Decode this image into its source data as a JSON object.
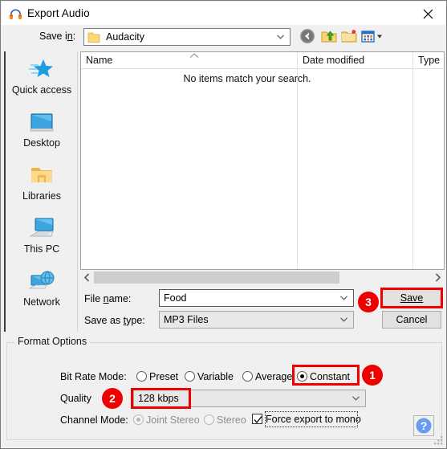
{
  "window": {
    "title": "Export Audio",
    "icon": "audacity-headphones-icon",
    "close_label": "✕"
  },
  "navbar": {
    "save_in_label": "Save in:",
    "save_in_value": "Audacity",
    "buttons": [
      {
        "name": "back-button",
        "icon": "back-arrow-icon"
      },
      {
        "name": "up-one-level-button",
        "icon": "up-folder-icon"
      },
      {
        "name": "new-folder-button",
        "icon": "new-folder-icon"
      },
      {
        "name": "view-mode-button",
        "icon": "views-dropdown-icon"
      }
    ]
  },
  "places": [
    {
      "label": "Quick access",
      "icon": "quick-access-star-icon"
    },
    {
      "label": "Desktop",
      "icon": "desktop-monitor-icon"
    },
    {
      "label": "Libraries",
      "icon": "libraries-folder-icon"
    },
    {
      "label": "This PC",
      "icon": "this-pc-icon"
    },
    {
      "label": "Network",
      "icon": "network-globe-icon"
    }
  ],
  "file_list": {
    "columns": [
      "Name",
      "Date modified",
      "Type"
    ],
    "empty_message": "No items match your search.",
    "sort_indicator": "ascending-caret-icon",
    "rows": []
  },
  "form": {
    "file_name_label": "File name:",
    "file_name_value": "Food",
    "save_as_type_label": "Save as type:",
    "save_as_type_value": "MP3 Files",
    "save_button": "Save",
    "cancel_button": "Cancel"
  },
  "format_options": {
    "group_title": "Format Options",
    "bit_rate_mode_label": "Bit Rate Mode:",
    "bit_rate_modes": [
      {
        "label": "Preset",
        "selected": false
      },
      {
        "label": "Variable",
        "selected": false
      },
      {
        "label": "Average",
        "selected": false
      },
      {
        "label": "Constant",
        "selected": true
      }
    ],
    "quality_label": "Quality",
    "quality_value": "128 kbps",
    "channel_mode_label": "Channel Mode:",
    "channel_modes": [
      {
        "label": "Joint Stereo",
        "selected": true,
        "disabled": true
      },
      {
        "label": "Stereo",
        "selected": false,
        "disabled": true
      }
    ],
    "force_mono_label": "Force export to mono",
    "force_mono_checked": true,
    "help_button": "?"
  },
  "annotations": {
    "accent_color": "#ee0000",
    "badges": [
      {
        "number": "1",
        "target": "constant-radio"
      },
      {
        "number": "2",
        "target": "quality-dropdown"
      },
      {
        "number": "3",
        "target": "save-button"
      }
    ]
  }
}
